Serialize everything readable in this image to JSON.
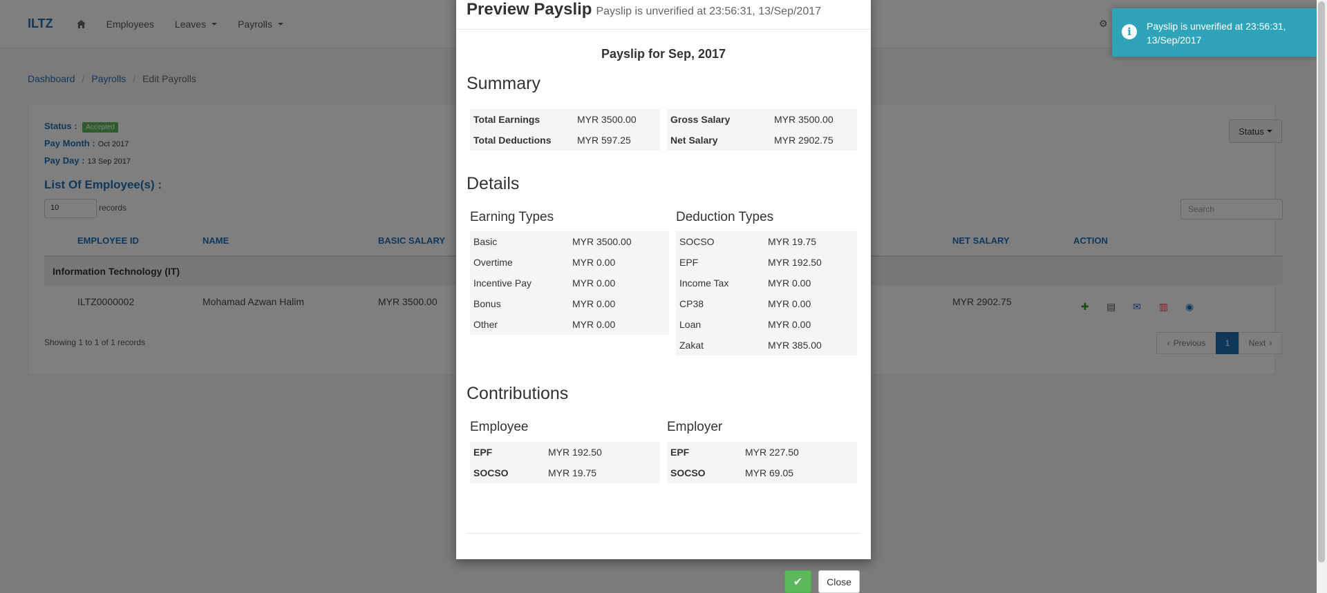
{
  "nav": {
    "brand": "ILTZ",
    "home_icon": "home-icon",
    "items": [
      "Employees",
      "Leaves",
      "Payrolls"
    ],
    "right_icon": "gear-icon"
  },
  "breadcrumb": [
    "Dashboard",
    "Payrolls",
    "Edit Payrolls"
  ],
  "payroll": {
    "status_label": "Status :",
    "status_value": "Accepted",
    "pay_month_label": "Pay Month :",
    "pay_month_value": "Oct 2017",
    "pay_day_label": "Pay Day :",
    "pay_day_value": "13 Sep 2017",
    "list_title": "List Of Employee(s) :",
    "status_button": "Status"
  },
  "table": {
    "length_value": "10",
    "length_label": "records",
    "search_placeholder": "Search",
    "headers": [
      "EMPLOYEE ID",
      "NAME",
      "BASIC SALARY",
      "NET SALARY",
      "ACTION"
    ],
    "group": "Information Technology (IT)",
    "row": {
      "employee_id": "ILTZ0000002",
      "name": "Mohamad Azwan Halim",
      "basic_salary": "MYR 3500.00",
      "net_salary": "MYR 2902.75"
    },
    "showing": "Showing 1 to 1 of 1 records",
    "pager": {
      "previous": "Previous",
      "page": "1",
      "next": "Next"
    }
  },
  "toast": {
    "icon": "info-icon",
    "text": "Payslip is unverified at 23:56:31, 13/Sep/2017",
    "color": "#2fa4b9"
  },
  "modal": {
    "title": "Preview Payslip",
    "subtitle": "Payslip is unverified at 23:56:31, 13/Sep/2017",
    "payslip_title": "Payslip for Sep, 2017",
    "summary_title": "Summary",
    "summary": {
      "total_earnings_label": "Total Earnings",
      "total_earnings": "MYR 3500.00",
      "total_deductions_label": "Total Deductions",
      "total_deductions": "MYR 597.25",
      "gross_salary_label": "Gross Salary",
      "gross_salary": "MYR 3500.00",
      "net_salary_label": "Net Salary",
      "net_salary": "MYR 2902.75"
    },
    "details_title": "Details",
    "earning_types_title": "Earning Types",
    "earnings": [
      {
        "label": "Basic",
        "value": "MYR 3500.00"
      },
      {
        "label": "Overtime",
        "value": "MYR 0.00"
      },
      {
        "label": "Incentive Pay",
        "value": "MYR 0.00"
      },
      {
        "label": "Bonus",
        "value": "MYR 0.00"
      },
      {
        "label": "Other",
        "value": "MYR 0.00"
      }
    ],
    "deduction_types_title": "Deduction Types",
    "deductions": [
      {
        "label": "SOCSO",
        "value": "MYR 19.75"
      },
      {
        "label": "EPF",
        "value": "MYR 192.50"
      },
      {
        "label": "Income Tax",
        "value": "MYR 0.00"
      },
      {
        "label": "CP38",
        "value": "MYR 0.00"
      },
      {
        "label": "Loan",
        "value": "MYR 0.00"
      },
      {
        "label": "Zakat",
        "value": "MYR 385.00"
      }
    ],
    "contributions_title": "Contributions",
    "employee_title": "Employee",
    "employee_contrib": [
      {
        "label": "EPF",
        "value": "MYR 192.50"
      },
      {
        "label": "SOCSO",
        "value": "MYR 19.75"
      }
    ],
    "employer_title": "Employer",
    "employer_contrib": [
      {
        "label": "EPF",
        "value": "MYR 227.50"
      },
      {
        "label": "SOCSO",
        "value": "MYR 69.05"
      }
    ],
    "close_label": "Close",
    "confirm_icon": "check-icon"
  }
}
